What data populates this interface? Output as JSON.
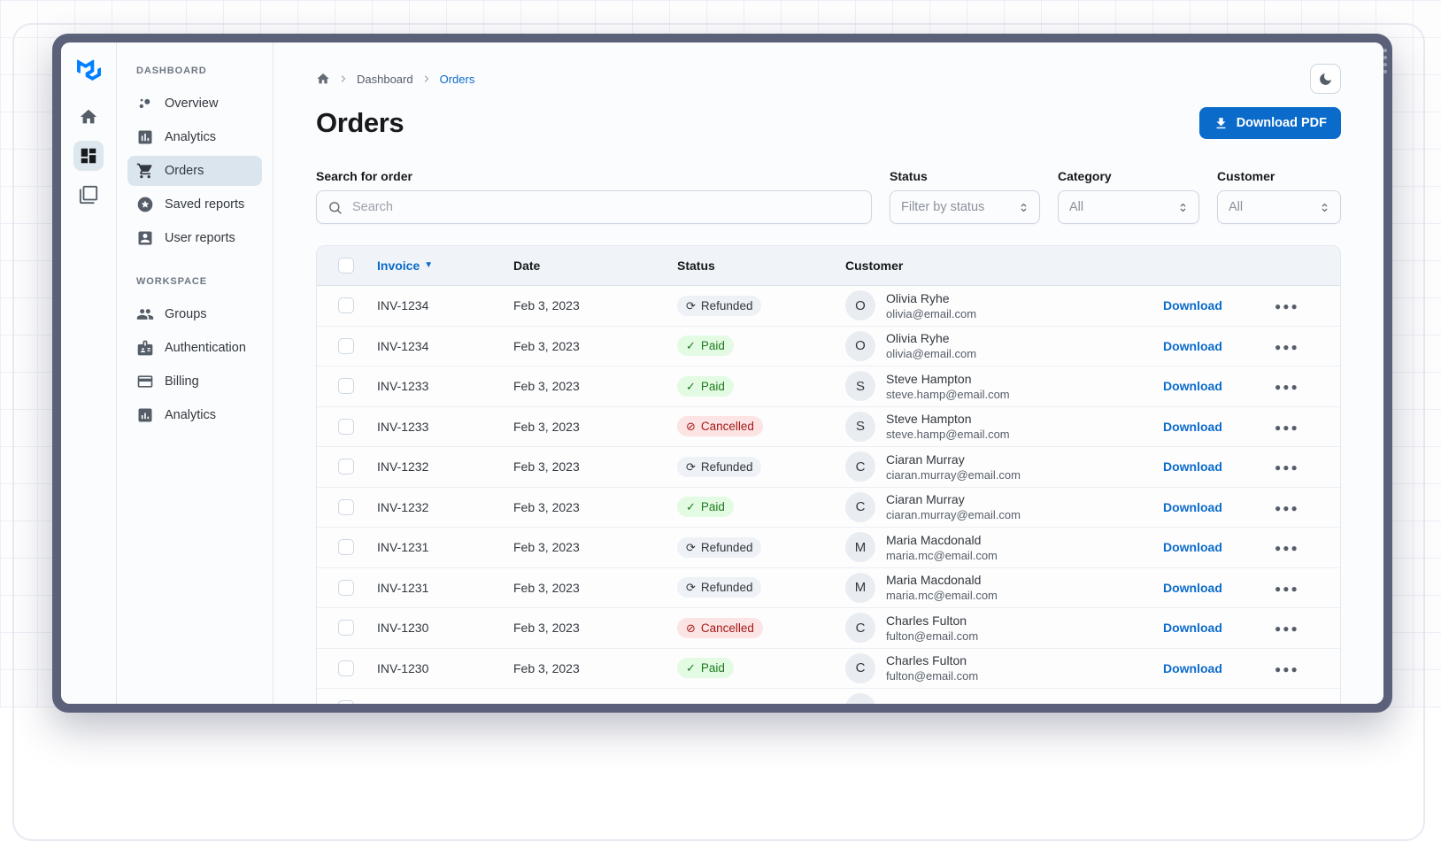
{
  "sidebar": {
    "sections": [
      {
        "label": "DASHBOARD",
        "items": [
          {
            "label": "Overview",
            "icon": "bubble-chart",
            "selected": false
          },
          {
            "label": "Analytics",
            "icon": "analytics-chart",
            "selected": false
          },
          {
            "label": "Orders",
            "icon": "shopping-cart",
            "selected": true
          },
          {
            "label": "Saved reports",
            "icon": "star-circle",
            "selected": false
          },
          {
            "label": "User reports",
            "icon": "user-box",
            "selected": false
          }
        ]
      },
      {
        "label": "WORKSPACE",
        "items": [
          {
            "label": "Groups",
            "icon": "people",
            "selected": false
          },
          {
            "label": "Authentication",
            "icon": "badge",
            "selected": false
          },
          {
            "label": "Billing",
            "icon": "credit-card",
            "selected": false
          },
          {
            "label": "Analytics",
            "icon": "bar-chart",
            "selected": false
          }
        ]
      }
    ]
  },
  "breadcrumb": {
    "items": [
      {
        "label": "Dashboard"
      },
      {
        "label": "Orders",
        "current": true
      }
    ]
  },
  "page": {
    "title": "Orders"
  },
  "toolbar": {
    "download_pdf_label": "Download PDF"
  },
  "filters": {
    "search": {
      "label": "Search for order",
      "placeholder": "Search"
    },
    "selects": [
      {
        "label": "Status",
        "value": "Filter by status",
        "width": "w-status"
      },
      {
        "label": "Category",
        "value": "All",
        "width": "w-category"
      },
      {
        "label": "Customer",
        "value": "All",
        "width": "w-customer"
      }
    ]
  },
  "table": {
    "columns": {
      "invoice": "Invoice",
      "date": "Date",
      "status": "Status",
      "customer": "Customer"
    },
    "sorted_by": "Invoice",
    "row_action_label": "Download",
    "status_meta": {
      "Refunded": {
        "variant": "neutral",
        "icon": "⟳"
      },
      "Paid": {
        "variant": "success",
        "icon": "✓"
      },
      "Cancelled": {
        "variant": "danger",
        "icon": "⊘"
      }
    },
    "rows": [
      {
        "invoice": "INV-1234",
        "date": "Feb 3, 2023",
        "status": "Refunded",
        "initial": "O",
        "name": "Olivia Ryhe",
        "email": "olivia@email.com"
      },
      {
        "invoice": "INV-1234",
        "date": "Feb 3, 2023",
        "status": "Paid",
        "initial": "O",
        "name": "Olivia Ryhe",
        "email": "olivia@email.com"
      },
      {
        "invoice": "INV-1233",
        "date": "Feb 3, 2023",
        "status": "Paid",
        "initial": "S",
        "name": "Steve Hampton",
        "email": "steve.hamp@email.com"
      },
      {
        "invoice": "INV-1233",
        "date": "Feb 3, 2023",
        "status": "Cancelled",
        "initial": "S",
        "name": "Steve Hampton",
        "email": "steve.hamp@email.com"
      },
      {
        "invoice": "INV-1232",
        "date": "Feb 3, 2023",
        "status": "Refunded",
        "initial": "C",
        "name": "Ciaran Murray",
        "email": "ciaran.murray@email.com"
      },
      {
        "invoice": "INV-1232",
        "date": "Feb 3, 2023",
        "status": "Paid",
        "initial": "C",
        "name": "Ciaran Murray",
        "email": "ciaran.murray@email.com"
      },
      {
        "invoice": "INV-1231",
        "date": "Feb 3, 2023",
        "status": "Refunded",
        "initial": "M",
        "name": "Maria Macdonald",
        "email": "maria.mc@email.com"
      },
      {
        "invoice": "INV-1231",
        "date": "Feb 3, 2023",
        "status": "Refunded",
        "initial": "M",
        "name": "Maria Macdonald",
        "email": "maria.mc@email.com"
      },
      {
        "invoice": "INV-1230",
        "date": "Feb 3, 2023",
        "status": "Cancelled",
        "initial": "C",
        "name": "Charles Fulton",
        "email": "fulton@email.com"
      },
      {
        "invoice": "INV-1230",
        "date": "Feb 3, 2023",
        "status": "Paid",
        "initial": "C",
        "name": "Charles Fulton",
        "email": "fulton@email.com"
      },
      {
        "invoice": "",
        "date": "",
        "status": "",
        "initial": "",
        "name": "",
        "email": "",
        "partial": true
      }
    ]
  },
  "colors": {
    "accent": "#0b6bcb",
    "frame": "#5a6178",
    "logo": "#007FFF",
    "selected_nav_bg": "#dbe5ed",
    "header_bg": "#f0f4f8",
    "chip_neutral_bg": "#eef1f5",
    "chip_neutral_text": "#32383e",
    "chip_success_bg": "#e3fbe3",
    "chip_success_text": "#1f7a1f",
    "chip_danger_bg": "#fce4e4",
    "chip_danger_text": "#a51818"
  }
}
